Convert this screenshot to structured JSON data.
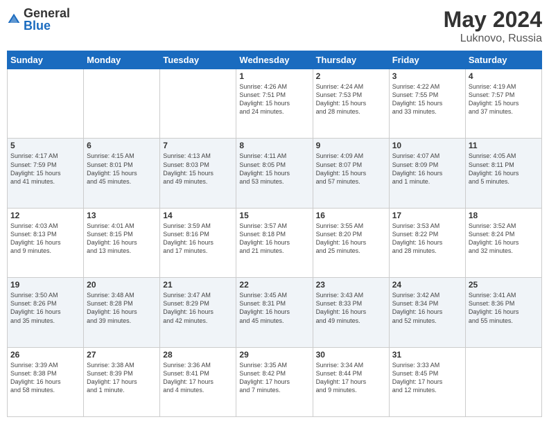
{
  "header": {
    "logo_general": "General",
    "logo_blue": "Blue",
    "month_title": "May 2024",
    "location": "Luknovo, Russia"
  },
  "days_of_week": [
    "Sunday",
    "Monday",
    "Tuesday",
    "Wednesday",
    "Thursday",
    "Friday",
    "Saturday"
  ],
  "weeks": [
    {
      "days": [
        {
          "num": "",
          "info": ""
        },
        {
          "num": "",
          "info": ""
        },
        {
          "num": "",
          "info": ""
        },
        {
          "num": "1",
          "info": "Sunrise: 4:26 AM\nSunset: 7:51 PM\nDaylight: 15 hours\nand 24 minutes."
        },
        {
          "num": "2",
          "info": "Sunrise: 4:24 AM\nSunset: 7:53 PM\nDaylight: 15 hours\nand 28 minutes."
        },
        {
          "num": "3",
          "info": "Sunrise: 4:22 AM\nSunset: 7:55 PM\nDaylight: 15 hours\nand 33 minutes."
        },
        {
          "num": "4",
          "info": "Sunrise: 4:19 AM\nSunset: 7:57 PM\nDaylight: 15 hours\nand 37 minutes."
        }
      ]
    },
    {
      "days": [
        {
          "num": "5",
          "info": "Sunrise: 4:17 AM\nSunset: 7:59 PM\nDaylight: 15 hours\nand 41 minutes."
        },
        {
          "num": "6",
          "info": "Sunrise: 4:15 AM\nSunset: 8:01 PM\nDaylight: 15 hours\nand 45 minutes."
        },
        {
          "num": "7",
          "info": "Sunrise: 4:13 AM\nSunset: 8:03 PM\nDaylight: 15 hours\nand 49 minutes."
        },
        {
          "num": "8",
          "info": "Sunrise: 4:11 AM\nSunset: 8:05 PM\nDaylight: 15 hours\nand 53 minutes."
        },
        {
          "num": "9",
          "info": "Sunrise: 4:09 AM\nSunset: 8:07 PM\nDaylight: 15 hours\nand 57 minutes."
        },
        {
          "num": "10",
          "info": "Sunrise: 4:07 AM\nSunset: 8:09 PM\nDaylight: 16 hours\nand 1 minute."
        },
        {
          "num": "11",
          "info": "Sunrise: 4:05 AM\nSunset: 8:11 PM\nDaylight: 16 hours\nand 5 minutes."
        }
      ]
    },
    {
      "days": [
        {
          "num": "12",
          "info": "Sunrise: 4:03 AM\nSunset: 8:13 PM\nDaylight: 16 hours\nand 9 minutes."
        },
        {
          "num": "13",
          "info": "Sunrise: 4:01 AM\nSunset: 8:15 PM\nDaylight: 16 hours\nand 13 minutes."
        },
        {
          "num": "14",
          "info": "Sunrise: 3:59 AM\nSunset: 8:16 PM\nDaylight: 16 hours\nand 17 minutes."
        },
        {
          "num": "15",
          "info": "Sunrise: 3:57 AM\nSunset: 8:18 PM\nDaylight: 16 hours\nand 21 minutes."
        },
        {
          "num": "16",
          "info": "Sunrise: 3:55 AM\nSunset: 8:20 PM\nDaylight: 16 hours\nand 25 minutes."
        },
        {
          "num": "17",
          "info": "Sunrise: 3:53 AM\nSunset: 8:22 PM\nDaylight: 16 hours\nand 28 minutes."
        },
        {
          "num": "18",
          "info": "Sunrise: 3:52 AM\nSunset: 8:24 PM\nDaylight: 16 hours\nand 32 minutes."
        }
      ]
    },
    {
      "days": [
        {
          "num": "19",
          "info": "Sunrise: 3:50 AM\nSunset: 8:26 PM\nDaylight: 16 hours\nand 35 minutes."
        },
        {
          "num": "20",
          "info": "Sunrise: 3:48 AM\nSunset: 8:28 PM\nDaylight: 16 hours\nand 39 minutes."
        },
        {
          "num": "21",
          "info": "Sunrise: 3:47 AM\nSunset: 8:29 PM\nDaylight: 16 hours\nand 42 minutes."
        },
        {
          "num": "22",
          "info": "Sunrise: 3:45 AM\nSunset: 8:31 PM\nDaylight: 16 hours\nand 45 minutes."
        },
        {
          "num": "23",
          "info": "Sunrise: 3:43 AM\nSunset: 8:33 PM\nDaylight: 16 hours\nand 49 minutes."
        },
        {
          "num": "24",
          "info": "Sunrise: 3:42 AM\nSunset: 8:34 PM\nDaylight: 16 hours\nand 52 minutes."
        },
        {
          "num": "25",
          "info": "Sunrise: 3:41 AM\nSunset: 8:36 PM\nDaylight: 16 hours\nand 55 minutes."
        }
      ]
    },
    {
      "days": [
        {
          "num": "26",
          "info": "Sunrise: 3:39 AM\nSunset: 8:38 PM\nDaylight: 16 hours\nand 58 minutes."
        },
        {
          "num": "27",
          "info": "Sunrise: 3:38 AM\nSunset: 8:39 PM\nDaylight: 17 hours\nand 1 minute."
        },
        {
          "num": "28",
          "info": "Sunrise: 3:36 AM\nSunset: 8:41 PM\nDaylight: 17 hours\nand 4 minutes."
        },
        {
          "num": "29",
          "info": "Sunrise: 3:35 AM\nSunset: 8:42 PM\nDaylight: 17 hours\nand 7 minutes."
        },
        {
          "num": "30",
          "info": "Sunrise: 3:34 AM\nSunset: 8:44 PM\nDaylight: 17 hours\nand 9 minutes."
        },
        {
          "num": "31",
          "info": "Sunrise: 3:33 AM\nSunset: 8:45 PM\nDaylight: 17 hours\nand 12 minutes."
        },
        {
          "num": "",
          "info": ""
        }
      ]
    }
  ]
}
